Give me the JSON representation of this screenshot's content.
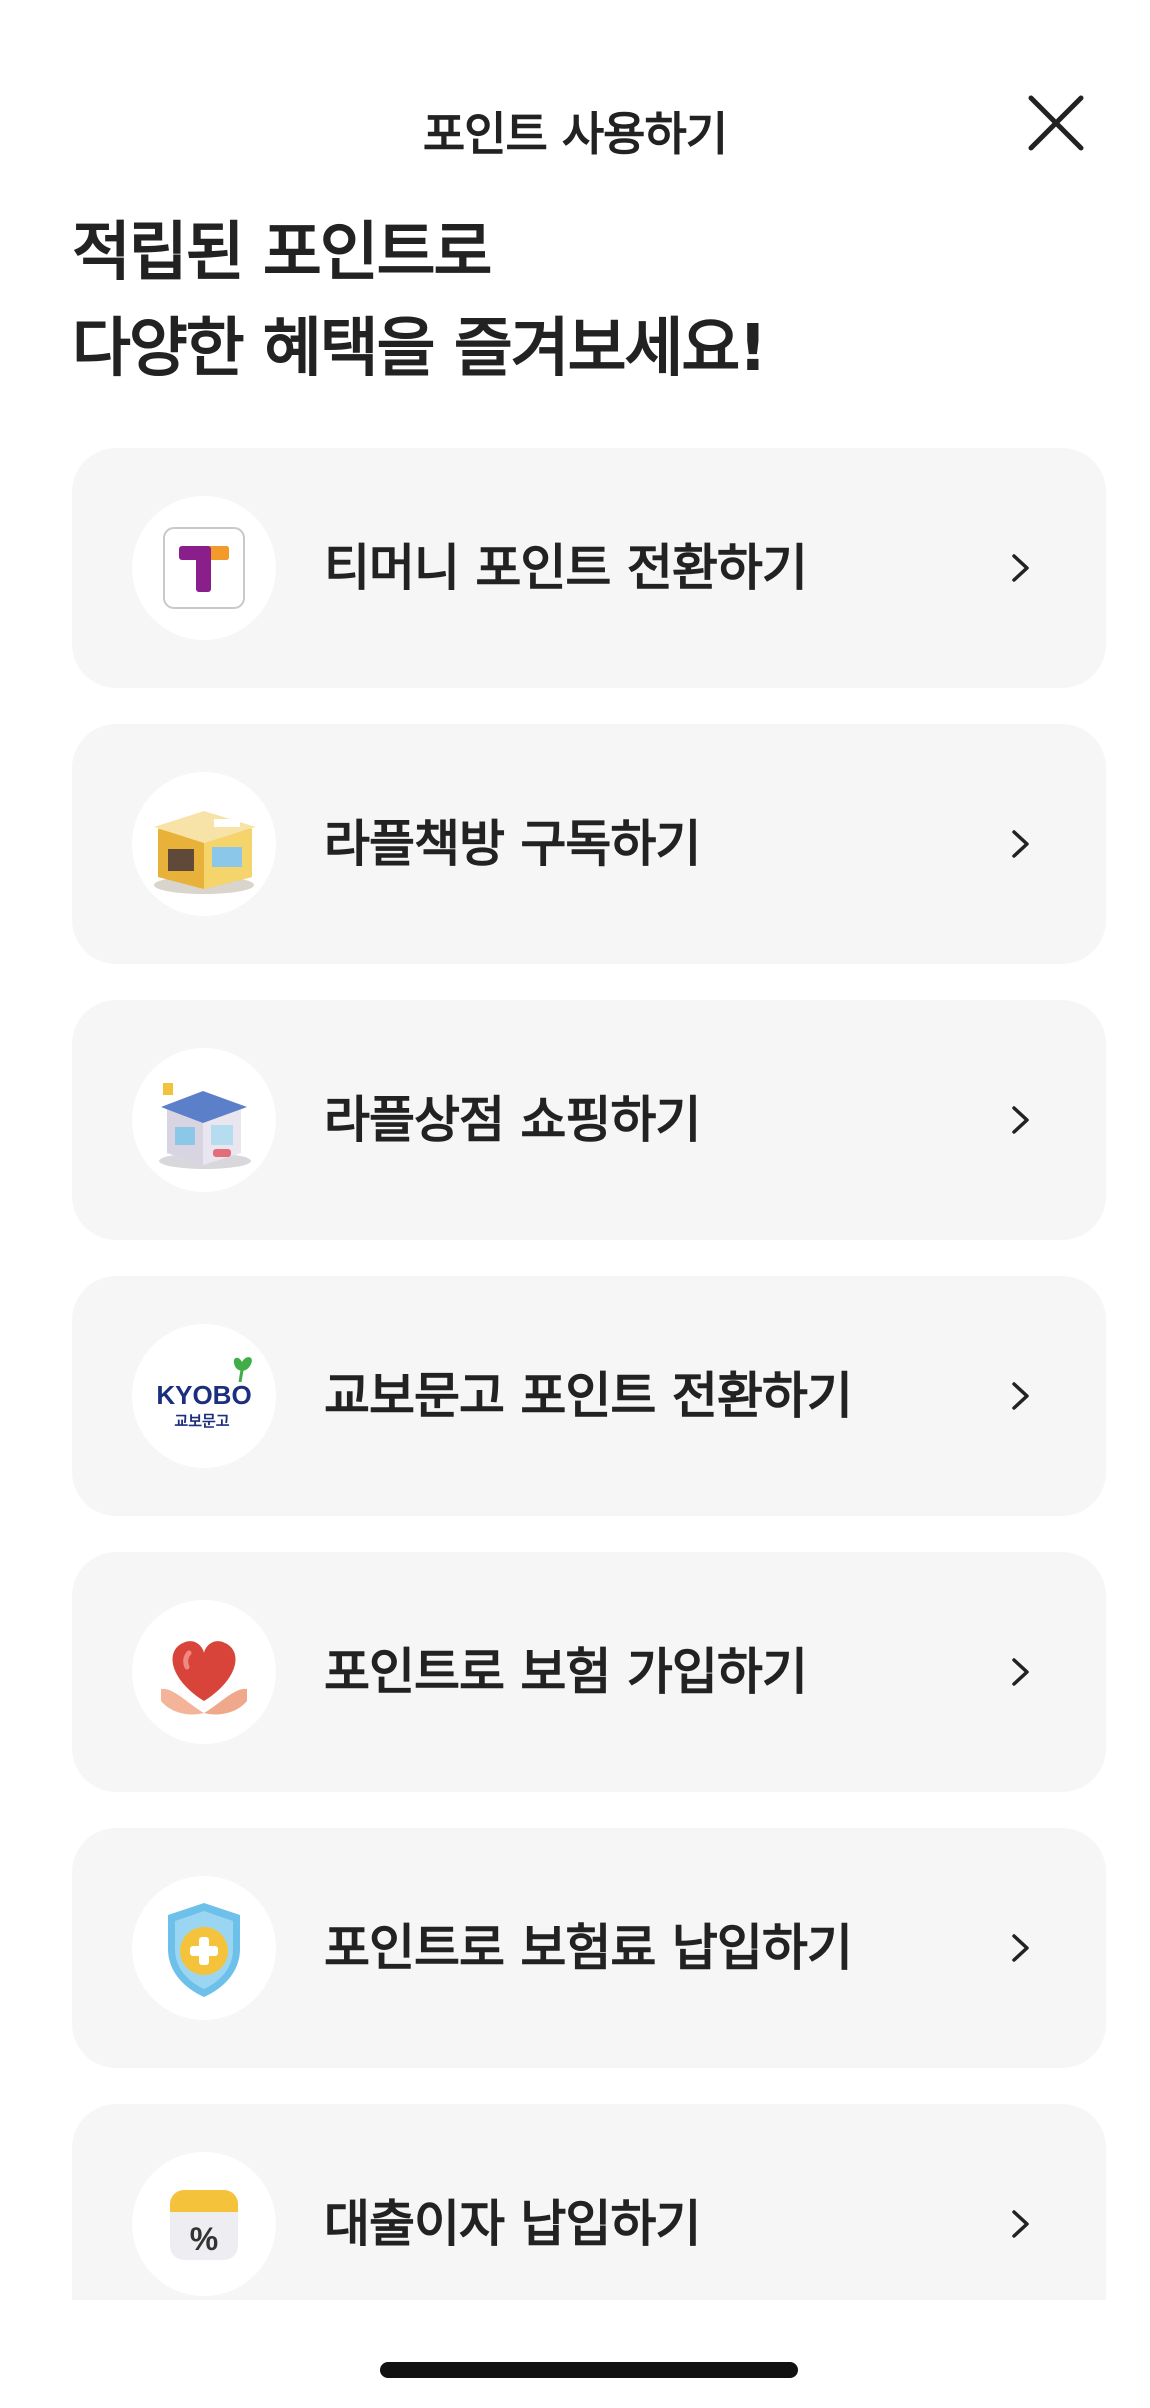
{
  "header": {
    "title": "포인트 사용하기"
  },
  "intro": {
    "line1": "적립된 포인트로",
    "line2": "다양한 혜택을 즐겨보세요!"
  },
  "menu": [
    {
      "label": "티머니 포인트 전환하기",
      "icon": "tmoney-logo-icon"
    },
    {
      "label": "라플책방 구독하기",
      "icon": "bookstore-building-icon"
    },
    {
      "label": "라플상점 쇼핑하기",
      "icon": "shop-building-icon"
    },
    {
      "label": "교보문고 포인트 전환하기",
      "icon": "kyobo-logo-icon",
      "logo_text": "KYOBO",
      "logo_subtext": "교보문고"
    },
    {
      "label": "포인트로 보험 가입하기",
      "icon": "heart-hands-icon"
    },
    {
      "label": "포인트로 보험료 납입하기",
      "icon": "shield-plus-icon"
    },
    {
      "label": "대출이자 납입하기",
      "icon": "percent-calendar-icon"
    }
  ],
  "colors": {
    "card_background": "#f6f6f7",
    "text": "#222222",
    "tmoney_purple": "#8a1f8c",
    "tmoney_orange": "#f39a2b",
    "kyobo_navy": "#1c2f7d",
    "kyobo_green": "#3fae49",
    "heart_red": "#d9443a",
    "shield_blue": "#6cc0ea",
    "shield_yellow": "#f5c33b"
  }
}
